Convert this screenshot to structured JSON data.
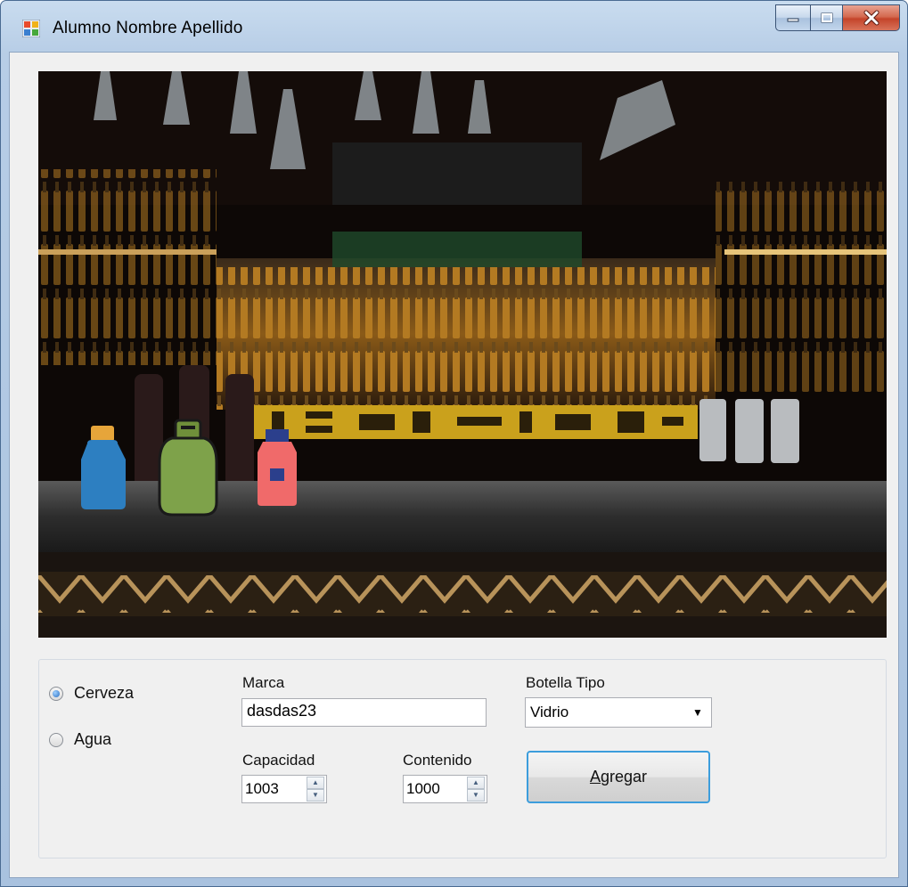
{
  "window": {
    "title": "Alumno Nombre Apellido",
    "icon": "app-icon",
    "buttons": {
      "minimize": "minimize-icon",
      "maximize": "maximize-icon",
      "close": "close-icon"
    }
  },
  "scene": {
    "description_icon": "bar-background-image",
    "bottles": [
      {
        "name": "blue-bottle",
        "color": "#2d7fc1"
      },
      {
        "name": "green-canteen-bottle",
        "color": "#7ea24a"
      },
      {
        "name": "pink-bottle",
        "color": "#f06a6a"
      }
    ]
  },
  "form": {
    "bebida_options": [
      {
        "label": "Cerveza",
        "checked": true
      },
      {
        "label": "Agua",
        "checked": false
      }
    ],
    "marca_label": "Marca",
    "marca_value": "dasdas23",
    "capacidad_label": "Capacidad",
    "capacidad_value": "1003",
    "contenido_label": "Contenido",
    "contenido_value": "1000",
    "botella_tipo_label": "Botella Tipo",
    "botella_tipo_value": "Vidrio",
    "agregar_label": "Agregar"
  }
}
